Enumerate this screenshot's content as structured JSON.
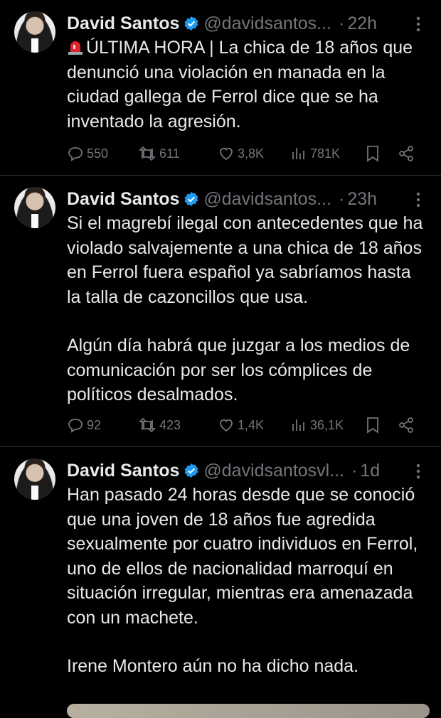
{
  "tweets": [
    {
      "name": "David Santos",
      "handle": "@davidsantos...",
      "time": "22h",
      "paragraphs": [
        "ÚLTIMA HORA | La chica de 18 años que denunció una violación en manada en la ciudad gallega de Ferrol dice que se ha inventado la agresión."
      ],
      "replies": "550",
      "reposts": "611",
      "likes": "3,8K",
      "views": "781K"
    },
    {
      "name": "David Santos",
      "handle": "@davidsantos...",
      "time": "23h",
      "paragraphs": [
        "Si el magrebí ilegal con antecedentes que ha violado salvajemente a una chica de 18 años en Ferrol fuera español ya sabríamos hasta la talla de cazoncillos que usa.",
        "Algún día habrá que juzgar a los medios de comunicación por ser los cómplices de políticos desalmados."
      ],
      "replies": "92",
      "reposts": "423",
      "likes": "1,4K",
      "views": "36,1K"
    },
    {
      "name": "David Santos",
      "handle": "@davidsantosvl...",
      "time": "1d",
      "paragraphs": [
        "Han pasado 24 horas desde que se conoció que una joven de 18 años fue agredida sexualmente por cuatro individuos en Ferrol, uno de ellos de nacionalidad marroquí en situación irregular, mientras era amenazada con un machete.",
        "Irene Montero aún no ha dicho nada."
      ]
    }
  ],
  "colors": {
    "background": "#000000",
    "text": "#e7e9ea",
    "muted": "#71767b",
    "verified": "#1d9bf0",
    "divider": "#2f3336"
  }
}
